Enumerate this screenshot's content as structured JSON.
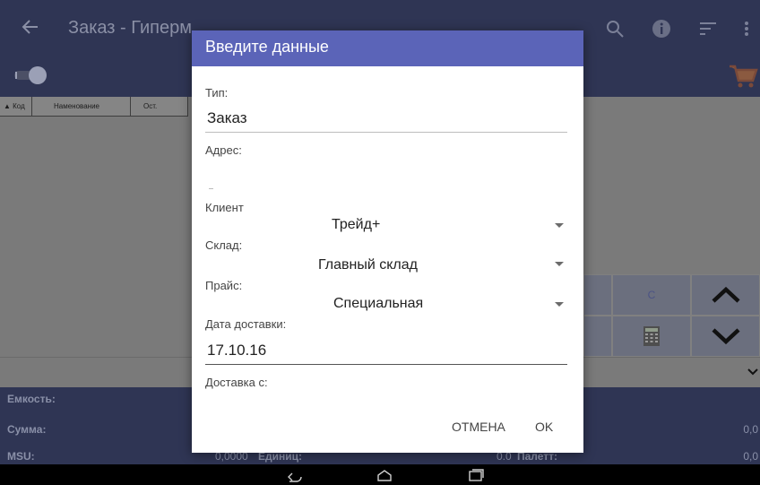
{
  "app": {
    "title": "Заказ - Гиперм",
    "grid_columns": [
      "▲ Код",
      "Наменование",
      "Ост."
    ],
    "keypad": {
      "c_label": "C"
    },
    "summary": {
      "capacity_label": "Емкость:",
      "sum_label": "Сумма:",
      "msu_label": "MSU:",
      "sum_right": "0,0",
      "msu_right": "0,0",
      "msu_mid_value": "0,0000",
      "units_label": "Единиц:",
      "pallets_value": "0.0",
      "pallets_label": "Палетт:"
    }
  },
  "dialog": {
    "title": "Введите данные",
    "type_label": "Тип:",
    "type_value": "Заказ",
    "address_label": "Адрес:",
    "client_label": "Клиент",
    "client_value": "Трейд+",
    "warehouse_label": "Склад:",
    "warehouse_value": "Главный склад",
    "price_label": "Прайс:",
    "price_value": "Специальная",
    "delivery_date_label": "Дата доставки:",
    "delivery_date_value": "17.10.16",
    "delivery_from_label": "Доставка с:",
    "cancel_label": "ОТМЕНА",
    "ok_label": "OK"
  },
  "colors": {
    "dialog_header": "#5b64b8",
    "appbar": "#2f3554",
    "dim_background": "#7a7a7a"
  }
}
